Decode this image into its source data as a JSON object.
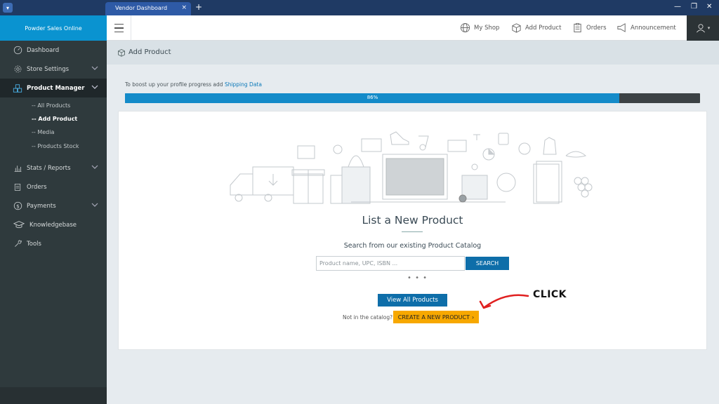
{
  "browser": {
    "tab_title": "Vendor Dashboard",
    "tab_close": "×",
    "new_tab": "+"
  },
  "brand": {
    "name": "Powder Sales Online"
  },
  "topnav": {
    "items": [
      {
        "label": "My Shop",
        "icon": "globe-icon"
      },
      {
        "label": "Add Product",
        "icon": "box-icon"
      },
      {
        "label": "Orders",
        "icon": "clipboard-icon"
      },
      {
        "label": "Announcement",
        "icon": "megaphone-icon"
      }
    ]
  },
  "sidebar": {
    "items": [
      {
        "label": "Dashboard",
        "icon": "dashboard-icon"
      },
      {
        "label": "Store Settings",
        "icon": "gear-icon"
      },
      {
        "label": "Product Manager",
        "icon": "boxes-icon"
      },
      {
        "label": "Stats / Reports",
        "icon": "chart-icon"
      },
      {
        "label": "Orders",
        "icon": "clipboard-icon"
      },
      {
        "label": "Payments",
        "icon": "dollar-icon"
      },
      {
        "label": "Knowledgebase",
        "icon": "graduation-cap-icon"
      },
      {
        "label": "Tools",
        "icon": "wrench-icon"
      }
    ],
    "subitems": [
      {
        "label": "-- All Products"
      },
      {
        "label": "-- Add Product"
      },
      {
        "label": "-- Media"
      },
      {
        "label": "-- Products Stock"
      }
    ]
  },
  "page": {
    "title": "Add Product"
  },
  "progress": {
    "text": "To boost up your profile progress add ",
    "link": "Shipping Data",
    "percent": 86,
    "label": "86%"
  },
  "main": {
    "heading": "List a New Product",
    "subheading": "Search from our existing Product Catalog",
    "search_placeholder": "Product name, UPC, ISBN ...",
    "search_button": "SEARCH",
    "dots": "• • •",
    "view_all": "View All Products",
    "not_in_catalog": "Not in the catalog?",
    "create_button": "CREATE A NEW PRODUCT",
    "create_chevron": "›"
  },
  "annotation": {
    "label": "CLICK",
    "color": "#e02020"
  },
  "colors": {
    "brand": "#0a93d0",
    "sidebar": "#2f3a3d",
    "primary_button": "#0e6ea9",
    "create_button": "#f7a800"
  }
}
